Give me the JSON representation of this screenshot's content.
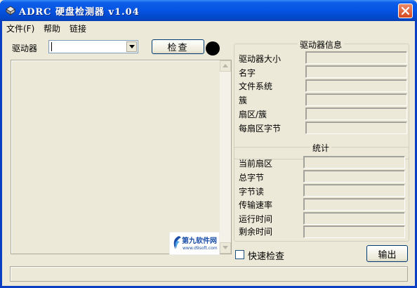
{
  "window": {
    "title": "ADRC 硬盘检测器 v1.04"
  },
  "menu": [
    {
      "label": "文件(F)"
    },
    {
      "label": "帮助"
    },
    {
      "label": "链接"
    }
  ],
  "drive": {
    "label": "驱动器",
    "selected": ""
  },
  "toolbar": {
    "check_label": "检查",
    "status_color": "#000000"
  },
  "watermark": {
    "title": "第九软件网",
    "url": "www.d9soft.com"
  },
  "drive_info": {
    "title": "驱动器信息",
    "rows": [
      {
        "label": "驱动器大小",
        "value": ""
      },
      {
        "label": "名字",
        "value": ""
      },
      {
        "label": "文件系统",
        "value": ""
      },
      {
        "label": "簇",
        "value": ""
      },
      {
        "label": "扇区/簇",
        "value": ""
      },
      {
        "label": "每扇区字节",
        "value": ""
      }
    ]
  },
  "stats": {
    "title": "统计",
    "rows": [
      {
        "label": "当前扇区",
        "value": ""
      },
      {
        "label": "总字节",
        "value": ""
      },
      {
        "label": "字节读",
        "value": ""
      },
      {
        "label": "传输速率",
        "value": ""
      },
      {
        "label": "运行时间",
        "value": ""
      },
      {
        "label": "剩余时间",
        "value": ""
      }
    ]
  },
  "options": {
    "fast_check_label": "快速检查",
    "fast_check_checked": false
  },
  "actions": {
    "exit_label": "输出"
  },
  "status": {
    "text": ""
  },
  "colors": {
    "titlebar": "#0554e3",
    "face": "#ece9d8",
    "close": "#d8481f"
  }
}
